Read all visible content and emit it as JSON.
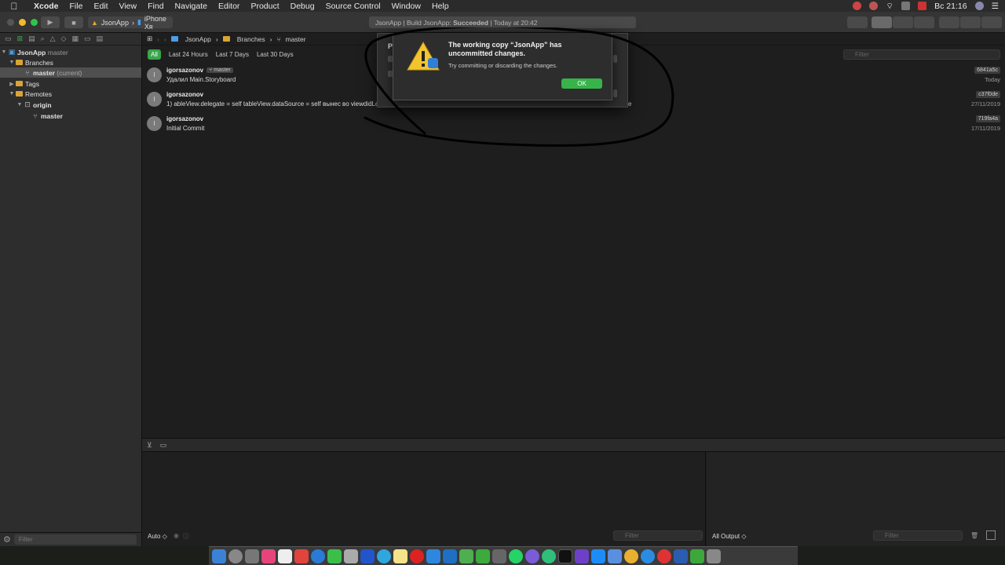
{
  "menubar": {
    "app_name": "Xcode",
    "items": [
      "File",
      "Edit",
      "View",
      "Find",
      "Navigate",
      "Editor",
      "Product",
      "Debug",
      "Source Control",
      "Window",
      "Help"
    ],
    "clock": "Вс 21:16"
  },
  "toolbar": {
    "scheme": "JsonApp",
    "destination": "iPhone Xʀ",
    "activity_prefix": "JsonApp | Build JsonApp: ",
    "activity_status": "Succeeded",
    "activity_suffix": " | Today at 20:42"
  },
  "navigator": {
    "project": "JsonApp",
    "project_branch": "master",
    "branches_label": "Branches",
    "current_branch": "master",
    "current_suffix": "(current)",
    "tags_label": "Tags",
    "remotes_label": "Remotes",
    "remote_name": "origin",
    "remote_branch": "master",
    "filter_placeholder": "Filter"
  },
  "jumpbar": {
    "project": "JsonApp",
    "group": "Branches",
    "branch": "master"
  },
  "filters": {
    "all": "All",
    "day": "Last 24 Hours",
    "week": "Last 7 Days",
    "month": "Last 30 Days",
    "search_placeholder": "Filter"
  },
  "commits": [
    {
      "avatar": "I",
      "author": "igorsazonov",
      "badge": "master",
      "message": "Удалил Main.Storyboard",
      "hash": "6841a5c",
      "date": "Today"
    },
    {
      "avatar": "I",
      "author": "igorsazonov",
      "badge": "",
      "message": "1) ableView.delegate = self tableView.dataSource = self вынес во viewdidLoa",
      "message_tail": "e",
      "hash": "c37f0de",
      "date": "27/11/2019"
    },
    {
      "avatar": "I",
      "author": "igorsazonov",
      "badge": "",
      "message": "Initial Commit",
      "hash": "719fa4a",
      "date": "17/11/2019"
    }
  ],
  "alert": {
    "title": "The working copy “JsonApp” has uncommitted changes.",
    "message": "Try committing or discarding the changes.",
    "ok_label": "OK",
    "behind_letter": "P"
  },
  "debug": {
    "auto_label": "Auto ◇",
    "filter_placeholder": "Filter",
    "output_label": "All Output ◇"
  },
  "colors": {
    "accent_green": "#37b34a",
    "folder": "#d9a434"
  }
}
